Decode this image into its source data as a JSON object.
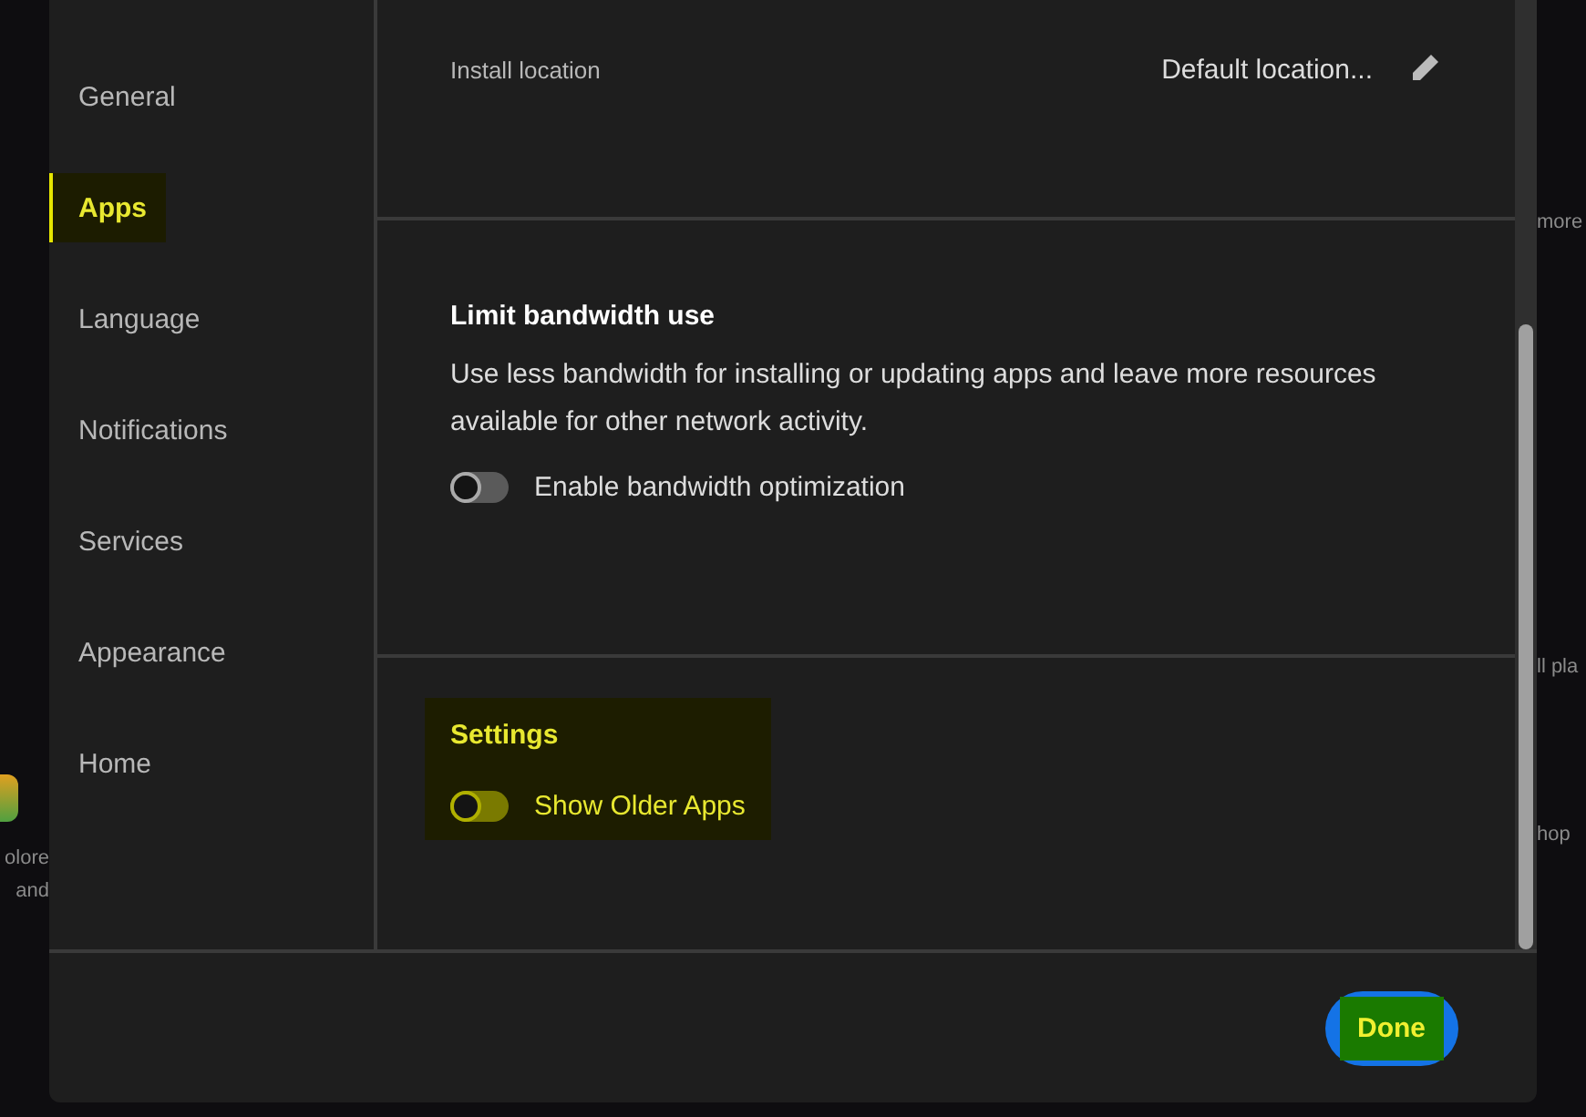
{
  "background": {
    "left_texts": [
      "olore",
      "and"
    ],
    "right_texts": [
      "more",
      "ll pla",
      "hop"
    ]
  },
  "sidebar": {
    "items": [
      {
        "label": "General",
        "selected": false,
        "highlighted": false
      },
      {
        "label": "Apps",
        "selected": true,
        "highlighted": true
      },
      {
        "label": "Language",
        "selected": false,
        "highlighted": false
      },
      {
        "label": "Notifications",
        "selected": false,
        "highlighted": false
      },
      {
        "label": "Services",
        "selected": false,
        "highlighted": false
      },
      {
        "label": "Appearance",
        "selected": false,
        "highlighted": false
      },
      {
        "label": "Home",
        "selected": false,
        "highlighted": false
      }
    ]
  },
  "install": {
    "label": "Install location",
    "value": "Default location..."
  },
  "bandwidth": {
    "title": "Limit bandwidth use",
    "description": "Use less bandwidth for installing or updating apps and leave more resources available for other network activity.",
    "toggle": {
      "label": "Enable bandwidth optimization",
      "on": false
    }
  },
  "settings": {
    "title": "Settings",
    "highlighted": true,
    "toggle": {
      "label": "Show Older Apps",
      "on": false
    }
  },
  "footer": {
    "button": {
      "label": "Done",
      "highlighted": true
    }
  }
}
